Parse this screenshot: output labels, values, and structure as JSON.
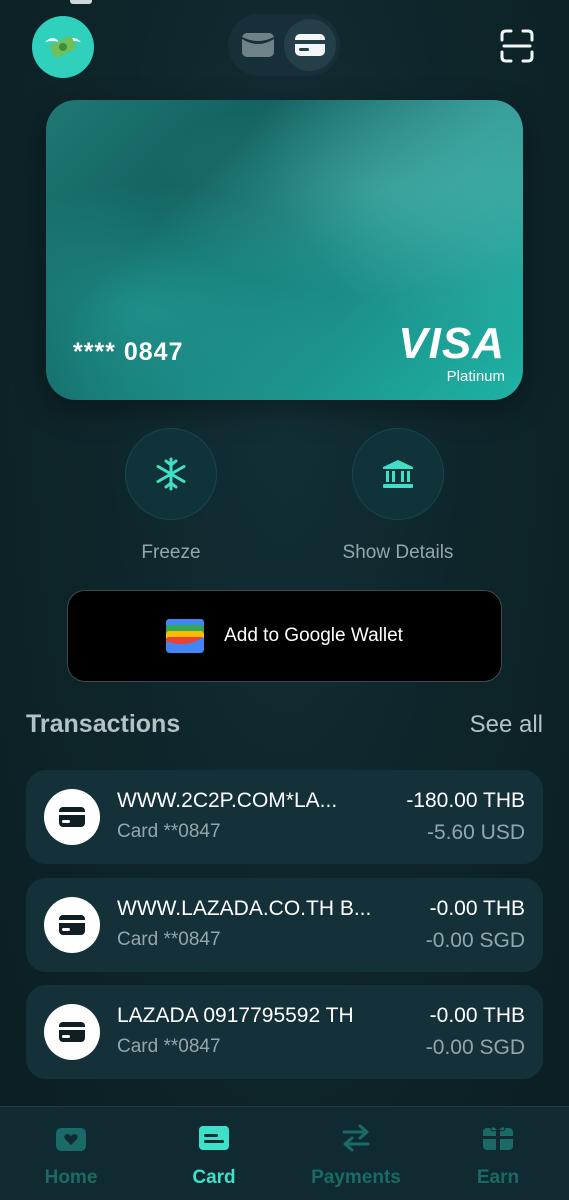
{
  "header": {
    "avatar_icon": "money-with-wings-icon",
    "toggle": [
      {
        "name": "wallet",
        "icon": "wallet-icon",
        "active": false
      },
      {
        "name": "card",
        "icon": "card-icon",
        "active": true
      }
    ],
    "scan_icon": "scan-icon"
  },
  "card": {
    "number": "**** 0847",
    "brand": "VISA",
    "tier": "Platinum"
  },
  "actions": {
    "freeze_label": "Freeze",
    "details_label": "Show Details"
  },
  "google_wallet": {
    "label": "Add to Google Wallet"
  },
  "transactions": {
    "title": "Transactions",
    "see_all": "See all",
    "items": [
      {
        "merchant": "WWW.2C2P.COM*LA...",
        "card": "Card **0847",
        "amount": "-180.00 THB",
        "sub_amount": "-5.60 USD"
      },
      {
        "merchant": "WWW.LAZADA.CO.TH B...",
        "card": "Card **0847",
        "amount": "-0.00 THB",
        "sub_amount": "-0.00 SGD"
      },
      {
        "merchant": "LAZADA 0917795592 TH",
        "card": "Card **0847",
        "amount": "-0.00 THB",
        "sub_amount": "-0.00 SGD"
      }
    ]
  },
  "nav": {
    "home": "Home",
    "card": "Card",
    "payments": "Payments",
    "earn": "Earn",
    "active": "card"
  },
  "colors": {
    "accent": "#3fe0c8",
    "background": "#0d2226",
    "card_teal": "#1fb3a5"
  }
}
